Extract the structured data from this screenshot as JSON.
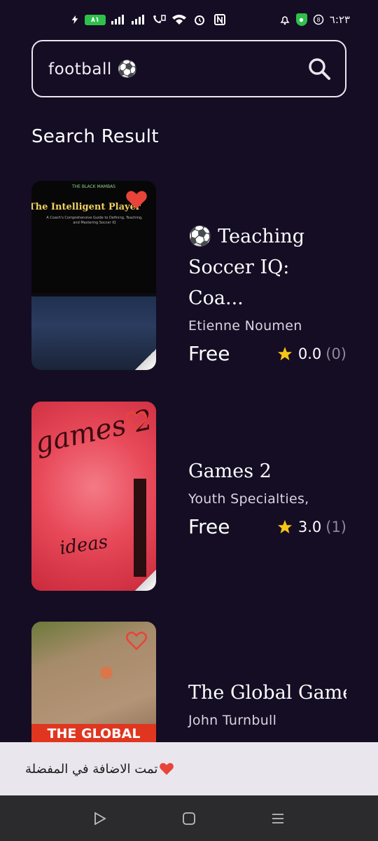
{
  "status_bar": {
    "battery": "٨١",
    "time": "٦:٢٣"
  },
  "search": {
    "value": "football ⚽"
  },
  "section_title": "Search Result",
  "books": [
    {
      "title_line1": "⚽ Teaching",
      "title_line2": "Soccer IQ: Coa...",
      "author": "Etienne Noumen",
      "price": "Free",
      "rating": "0.0",
      "rating_count": "(0)",
      "favorited": true,
      "cover_text": {
        "small": "THE BLACK MAMBAS",
        "title": "The Intelligent Player",
        "sub": "A Coach's Comprehensive Guide to Defining, Teaching, and Mastering Soccer IQ"
      }
    },
    {
      "title_line1": "Games 2",
      "author": "Youth Specialties,",
      "price": "Free",
      "rating": "3.0",
      "rating_count": "(1)",
      "favorited": false,
      "cover_text": {
        "title": "games 2",
        "ideas": "ideas"
      }
    },
    {
      "title_line1": "The Global Game",
      "author": "John Turnbull",
      "favorited": false,
      "cover_text": {
        "banner": "THE GLOBAL"
      }
    }
  ],
  "toast": {
    "message": "تمت الاضافة في المفضلة"
  },
  "colors": {
    "background": "#140d24",
    "heart": "#e8443a",
    "star": "#f5c518",
    "toast_bg": "#e9e6ee"
  }
}
